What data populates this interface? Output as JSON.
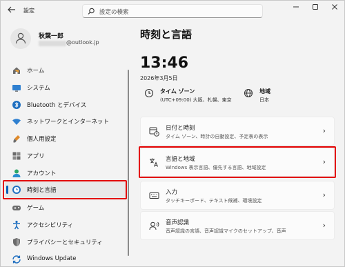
{
  "window": {
    "app_title": "設定",
    "search_placeholder": "設定の検索"
  },
  "profile": {
    "name": "秋葉一郎",
    "email_suffix": "@outlook.jp"
  },
  "nav": [
    {
      "label": "ホーム",
      "icon": "home-icon"
    },
    {
      "label": "システム",
      "icon": "monitor-icon"
    },
    {
      "label": "Bluetooth とデバイス",
      "icon": "bluetooth-icon"
    },
    {
      "label": "ネットワークとインターネット",
      "icon": "wifi-icon"
    },
    {
      "label": "個人用設定",
      "icon": "brush-icon"
    },
    {
      "label": "アプリ",
      "icon": "apps-icon"
    },
    {
      "label": "アカウント",
      "icon": "account-icon"
    },
    {
      "label": "時刻と言語",
      "icon": "time-language-icon",
      "selected": true
    },
    {
      "label": "ゲーム",
      "icon": "gamepad-icon"
    },
    {
      "label": "アクセシビリティ",
      "icon": "accessibility-icon"
    },
    {
      "label": "プライバシーとセキュリティ",
      "icon": "shield-icon"
    },
    {
      "label": "Windows Update",
      "icon": "update-icon"
    }
  ],
  "main": {
    "title": "時刻と言語",
    "time": "13:46",
    "date": "2026年3月5日",
    "timezone": {
      "label": "タイム ゾーン",
      "value": "(UTC+09:00) 大阪、札幌、東京"
    },
    "region": {
      "label": "地域",
      "value": "日本"
    },
    "cards": [
      {
        "title": "日付と時刻",
        "subtitle": "タイム ゾーン、時計の自動設定、予定表の表示",
        "icon": "calendar-clock-icon"
      },
      {
        "title": "言語と地域",
        "subtitle": "Windows 表示言語、優先する言語、地域設定",
        "icon": "language-icon",
        "highlighted": true
      },
      {
        "title": "入力",
        "subtitle": "タッチキーボード、テキスト候補、環境設定",
        "icon": "keyboard-icon"
      },
      {
        "title": "音声認識",
        "subtitle": "音声認識の言語、音声認識マイクのセットアップ、音声",
        "icon": "speech-icon"
      }
    ]
  },
  "colors": {
    "accent": "#005fb8",
    "highlight_border": "#e30000"
  }
}
